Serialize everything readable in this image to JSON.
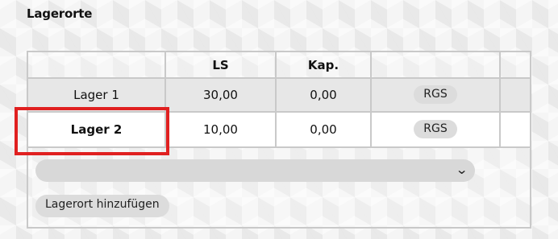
{
  "section": {
    "title": "Lagerorte"
  },
  "table": {
    "headers": [
      "",
      "LS",
      "Kap.",
      "",
      ""
    ],
    "rows": [
      {
        "name": "Lager 1",
        "ls": "30,00",
        "kap": "0,00",
        "action": "RGS"
      },
      {
        "name": "Lager 2",
        "ls": "10,00",
        "kap": "0,00",
        "action": "RGS"
      }
    ]
  },
  "select": {
    "value": ""
  },
  "add_button": {
    "label": "Lagerort hinzufügen"
  },
  "colors": {
    "highlight": "#e02020",
    "row_alt": "#e7e7e7",
    "border": "#c9c9c9"
  }
}
